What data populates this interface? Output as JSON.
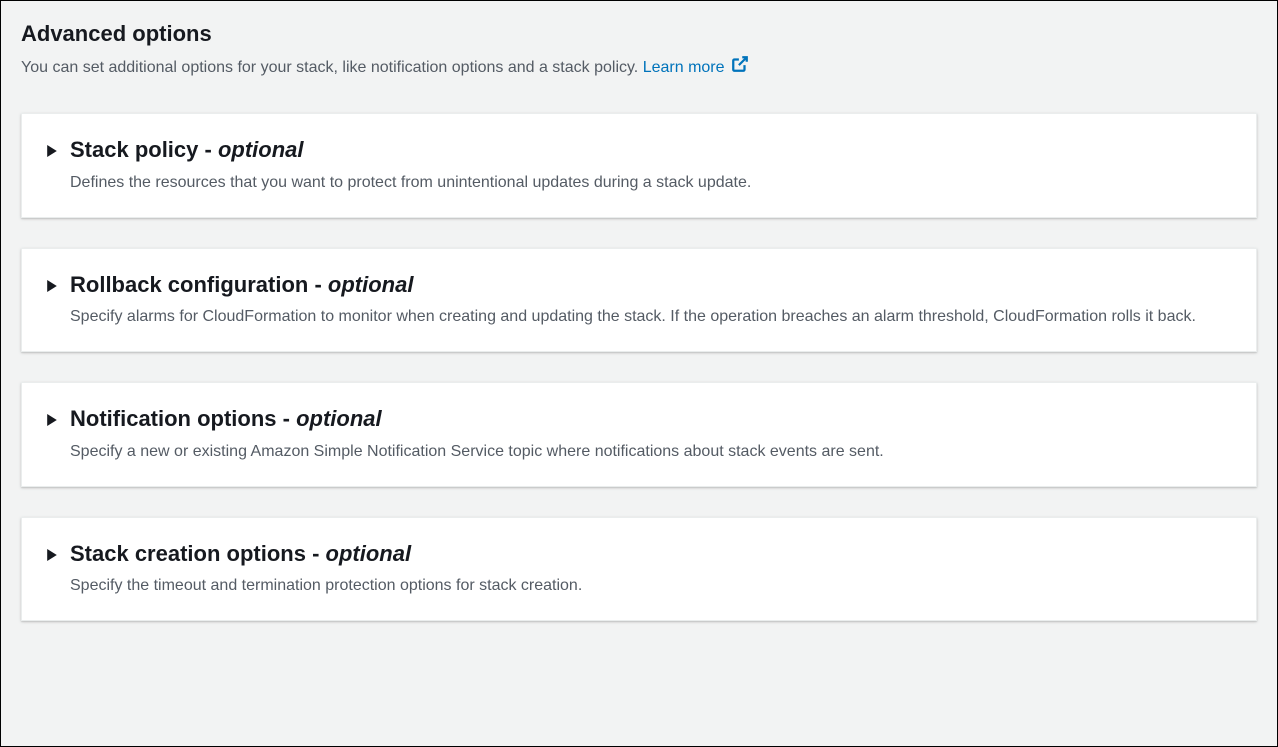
{
  "header": {
    "title": "Advanced options",
    "subtitle": "You can set additional options for your stack, like notification options and a stack policy. ",
    "learn_more": "Learn more"
  },
  "optional_label": "optional",
  "panels": [
    {
      "title": "Stack policy",
      "description": "Defines the resources that you want to protect from unintentional updates during a stack update."
    },
    {
      "title": "Rollback configuration",
      "description": "Specify alarms for CloudFormation to monitor when creating and updating the stack. If the operation breaches an alarm threshold, CloudFormation rolls it back."
    },
    {
      "title": "Notification options",
      "description": "Specify a new or existing Amazon Simple Notification Service topic where notifications about stack events are sent."
    },
    {
      "title": "Stack creation options",
      "description": "Specify the timeout and termination protection options for stack creation."
    }
  ]
}
